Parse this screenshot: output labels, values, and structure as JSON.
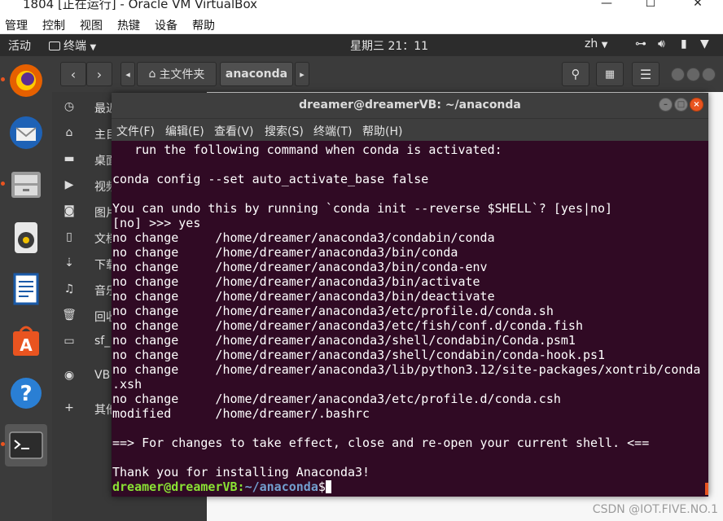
{
  "vbox": {
    "title": "1804 [正在运行] - Oracle VM VirtualBox",
    "menu": [
      "管理",
      "控制",
      "视图",
      "热键",
      "设备",
      "帮助"
    ]
  },
  "topbar": {
    "activities": "活动",
    "app_menu": "终端",
    "clock": "星期三 21：11",
    "input_method": "zh"
  },
  "dock": {
    "items": [
      "firefox-icon",
      "thunderbird-icon",
      "files-icon",
      "rhythmbox-icon",
      "writer-icon",
      "software-icon",
      "help-icon",
      "terminal-icon"
    ]
  },
  "file_manager": {
    "path_home": "主文件夹",
    "path_current": "anaconda",
    "sidebar": [
      "最近",
      "主目录",
      "桌面",
      "视频",
      "图片",
      "文档",
      "下载",
      "音乐",
      "回收站",
      "sf_",
      "VB",
      "其他"
    ]
  },
  "terminal": {
    "title": "dreamer@dreamerVB: ~/anaconda",
    "menu": [
      "文件(F)",
      "编辑(E)",
      "查看(V)",
      "搜索(S)",
      "终端(T)",
      "帮助(H)"
    ],
    "lines": [
      "   run the following command when conda is activated:",
      "",
      "conda config --set auto_activate_base false",
      "",
      "You can undo this by running `conda init --reverse $SHELL`? [yes|no]",
      "[no] >>> yes",
      "no change     /home/dreamer/anaconda3/condabin/conda",
      "no change     /home/dreamer/anaconda3/bin/conda",
      "no change     /home/dreamer/anaconda3/bin/conda-env",
      "no change     /home/dreamer/anaconda3/bin/activate",
      "no change     /home/dreamer/anaconda3/bin/deactivate",
      "no change     /home/dreamer/anaconda3/etc/profile.d/conda.sh",
      "no change     /home/dreamer/anaconda3/etc/fish/conf.d/conda.fish",
      "no change     /home/dreamer/anaconda3/shell/condabin/Conda.psm1",
      "no change     /home/dreamer/anaconda3/shell/condabin/conda-hook.ps1",
      "no change     /home/dreamer/anaconda3/lib/python3.12/site-packages/xontrib/conda",
      ".xsh",
      "no change     /home/dreamer/anaconda3/etc/profile.d/conda.csh",
      "modified      /home/dreamer/.bashrc",
      "",
      "==> For changes to take effect, close and re-open your current shell. <==",
      "",
      "Thank you for installing Anaconda3!"
    ],
    "prompt_user": "dreamer@dreamerVB",
    "prompt_path": "~/anaconda",
    "prompt_symbol": "$"
  },
  "watermark": "CSDN @IOT.FIVE.NO.1"
}
